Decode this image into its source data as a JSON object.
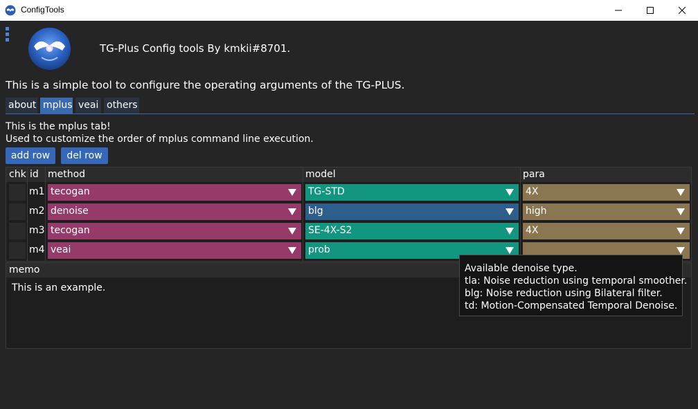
{
  "window": {
    "title": "ConfigTools",
    "controls": [
      "minimize-icon",
      "maximize-icon",
      "close-icon"
    ]
  },
  "header": {
    "title": "TG-Plus Config tools By kmkii#8701."
  },
  "intro": "This is a simple tool to configure the operating arguments of the TG-PLUS.",
  "tabs": [
    {
      "label": "about",
      "active": false
    },
    {
      "label": "mplus",
      "active": true
    },
    {
      "label": "veai",
      "active": false
    },
    {
      "label": "others",
      "active": false
    }
  ],
  "tab_content": {
    "line1": "This is the mplus tab!",
    "line2": "Used to customize the order of mplus command line execution."
  },
  "buttons": {
    "add_row": "add row",
    "del_row": "del row"
  },
  "table": {
    "headers": {
      "chk": "chk",
      "id": "id",
      "method": "method",
      "model": "model",
      "para": "para"
    },
    "rows": [
      {
        "id": "m1",
        "method": "tecogan",
        "model": "TG-STD",
        "para": "4X",
        "model_highlighted": false
      },
      {
        "id": "m2",
        "method": "denoise",
        "model": "blg",
        "para": "high",
        "model_highlighted": true
      },
      {
        "id": "m3",
        "method": "tecogan",
        "model": "SE-4X-S2",
        "para": "4X",
        "model_highlighted": false
      },
      {
        "id": "m4",
        "method": "veai",
        "model": "prob",
        "para": "",
        "model_highlighted": false
      }
    ]
  },
  "memo": {
    "label": "memo",
    "text": "This is an example."
  },
  "tooltip": {
    "lines": [
      "Available denoise type.",
      "tla: Noise reduction using temporal smoother.",
      "blg: Noise reduction using Bilateral filter.",
      "td: Motion-Compensated Temporal Denoise."
    ]
  },
  "colors": {
    "method_combo": "#963a6a",
    "model_combo": "#13967f",
    "model_combo_hover": "#2e5f8c",
    "para_combo": "#8a7752",
    "accent": "#3a6ab0"
  }
}
